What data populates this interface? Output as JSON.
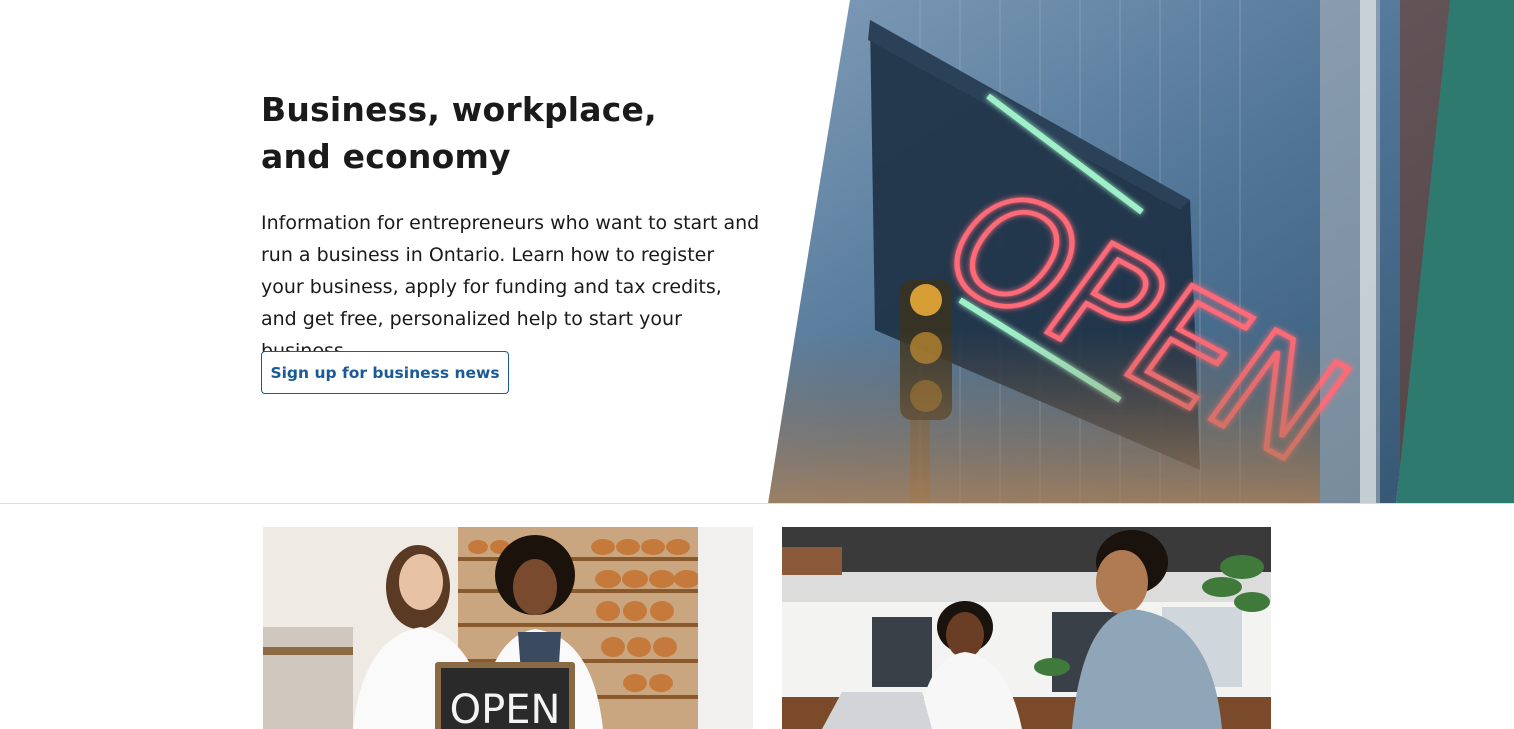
{
  "hero": {
    "title": "Business, workplace, and economy",
    "description": "Information for entrepreneurs who want to start and run a business in Ontario. Learn how to register your business, apply for funding and tax credits, and get free, personalized help to start your business.",
    "button_label": "Sign up for business news",
    "image_sign_text": "OPEN",
    "accent_color": "#2f7a6e",
    "button_color": "#1a5a96"
  },
  "cards": [
    {
      "image_name": "bakery-owners-photo",
      "sign_text": "OPEN"
    },
    {
      "image_name": "business-meeting-photo"
    }
  ]
}
